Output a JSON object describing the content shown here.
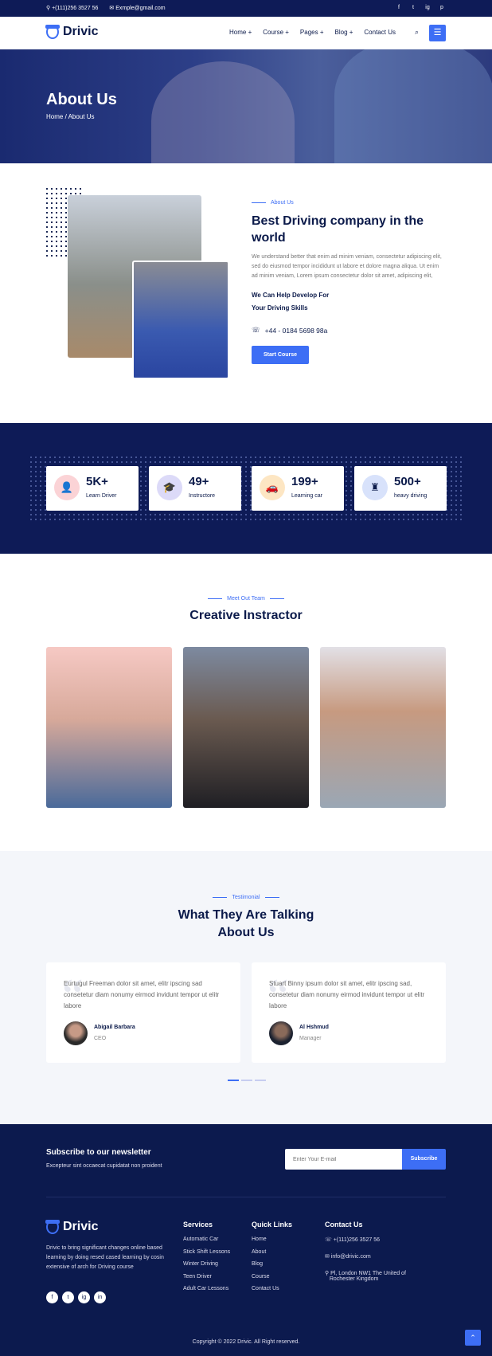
{
  "topbar": {
    "phone": "+(111)256 3527 56",
    "email": "Exmple@gmail.com",
    "social": [
      "f",
      "t",
      "ig",
      "p"
    ]
  },
  "nav": {
    "brand": "Drivic",
    "items": [
      "Home +",
      "Course +",
      "Pages +",
      "Blog +",
      "Contact Us"
    ],
    "search_icon": "search-icon",
    "menu_icon": "☰"
  },
  "hero": {
    "title": "About Us",
    "crumb": "Home / About Us"
  },
  "about": {
    "eyebrow": "About Us",
    "title": "Best Driving company in the world",
    "body": "We understand better that enim ad minim veniam, consectetur adipiscing elit, sed do eiusmod tempor incididunt ut labore et dolore magna aliqua. Ut enim ad minim veniam, Lorem ipsum consectetur dolor sit amet, adipiscing elit,",
    "sub1": "We Can Help Develop For",
    "sub2": "Your Driving Skills",
    "phone": "+44 - 0184 5698 98a",
    "button": "Start Course"
  },
  "stats": [
    {
      "num": "5K+",
      "label": "Learn Driver",
      "color": "#fbd3d6",
      "icon": "👤"
    },
    {
      "num": "49+",
      "label": "Instructore",
      "color": "#dcdaf8",
      "icon": "🎓"
    },
    {
      "num": "199+",
      "label": "Learning car",
      "color": "#fde6c3",
      "icon": "🚗"
    },
    {
      "num": "500+",
      "label": "heavy driving",
      "color": "#d8e2fb",
      "icon": "♜"
    }
  ],
  "team": {
    "eyebrow": "Meet Out Team",
    "title": "Creative Instractor"
  },
  "testimonial": {
    "eyebrow": "Testimonial",
    "title1": "What They Are Talking",
    "title2": "About Us",
    "cards": [
      {
        "text": "Eurtugul Freeman dolor sit amet, elitr ipscing sad consetetur diam nonumy eirmod invidunt tempor ut elitr labore",
        "name": "Abigail Barbara",
        "role": "CEO"
      },
      {
        "text": "Stuart Binny ipsum dolor sit amet, elitr ipscing sad, consetetur diam nonumy eirmod invidunt tempor ut elitr labore",
        "name": "Al Hshmud",
        "role": "Manager"
      }
    ]
  },
  "footer": {
    "sub_title": "Subscribe to our newsletter",
    "sub_text": "Excepteur sint occaecat cupidatat non proident",
    "placeholder": "Enter Your E-mail",
    "sub_btn": "Subscribe",
    "brand": "Drivic",
    "desc": "Drivic to bring significant changes online based learning by doing resed cased learning by cosin extensive of arch for Driving course",
    "social": [
      "f",
      "t",
      "ig",
      "in"
    ],
    "services_title": "Services",
    "services": [
      "Automatic Car",
      "Stick Shift Lessons",
      "Winter Driving",
      "Teen Driver",
      "Adult Car Lessons"
    ],
    "links_title": "Quick Links",
    "links": [
      "Home",
      "About",
      "Blog",
      "Course",
      "Contact Us"
    ],
    "contact_title": "Contact Us",
    "contact": [
      "+(111)256 3527 56",
      "info@drivic.com",
      "Pl, London NW1 The United of",
      "Rochester Kingdom"
    ],
    "copyright": "Copyright © 2022 Drivic. All Right reserved."
  }
}
